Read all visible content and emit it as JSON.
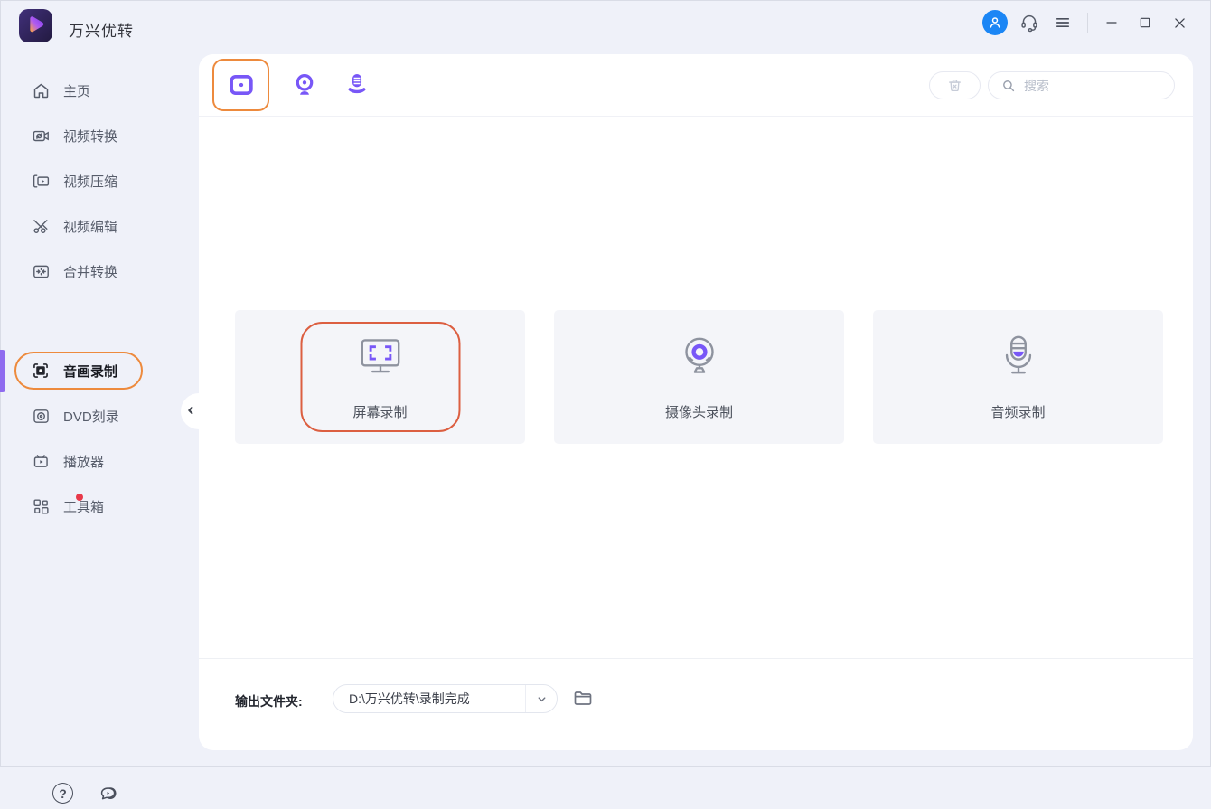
{
  "colors": {
    "accent_purple": "#7857f7",
    "accent_orange": "#ed8a3d",
    "highlight_red_orange": "#dc5f41",
    "avatar_blue": "#1b86f5",
    "badge_red": "#e8394a",
    "panel_bg": "#ffffff",
    "window_bg": "#eff1f9",
    "card_bg": "#f4f5f9"
  },
  "app": {
    "title": "万兴优转"
  },
  "topbar": {
    "avatar_icon": "user-icon",
    "headset_icon": "headset-icon",
    "menu_icon": "hamburger-menu-icon",
    "controls": [
      "minimize",
      "maximize",
      "close"
    ]
  },
  "sidebar": {
    "items": [
      {
        "label": "主页",
        "icon": "home-icon",
        "selected": false
      },
      {
        "label": "视频转换",
        "icon": "video-convert-icon",
        "selected": false
      },
      {
        "label": "视频压缩",
        "icon": "video-compress-icon",
        "selected": false
      },
      {
        "label": "视频编辑",
        "icon": "video-edit-icon",
        "selected": false
      },
      {
        "label": "合并转换",
        "icon": "merge-convert-icon",
        "selected": false
      },
      {
        "label": "音画录制",
        "icon": "screen-record-icon",
        "selected": true
      },
      {
        "label": "DVD刻录",
        "icon": "dvd-burn-icon",
        "selected": false
      },
      {
        "label": "播放器",
        "icon": "player-icon",
        "selected": false
      },
      {
        "label": "工具箱",
        "icon": "toolbox-icon",
        "selected": false,
        "badge": "red-dot"
      }
    ],
    "collapse_icon": "chevron-left-icon",
    "help_label": "?",
    "footer_icons": [
      "help-icon",
      "feedback-icon"
    ]
  },
  "main": {
    "tabs": [
      {
        "name": "screen-record-tab",
        "icon": "screen-record-icon",
        "selected": true
      },
      {
        "name": "webcam-record-tab",
        "icon": "webcam-icon",
        "selected": false
      },
      {
        "name": "audio-record-tab",
        "icon": "microphone-icon",
        "selected": false
      }
    ],
    "trash_button": {
      "icon": "trash-icon"
    },
    "search": {
      "placeholder": "搜索",
      "icon": "search-icon"
    },
    "cards": [
      {
        "label": "屏幕录制",
        "icon": "monitor-record-icon",
        "selected": true
      },
      {
        "label": "摄像头录制",
        "icon": "webcam-icon",
        "selected": false
      },
      {
        "label": "音频录制",
        "icon": "microphone-icon",
        "selected": false
      }
    ],
    "output": {
      "label": "输出文件夹:",
      "path": "D:\\万兴优转\\录制完成",
      "caret_icon": "chevron-down-icon",
      "folder_icon": "folder-icon"
    }
  }
}
